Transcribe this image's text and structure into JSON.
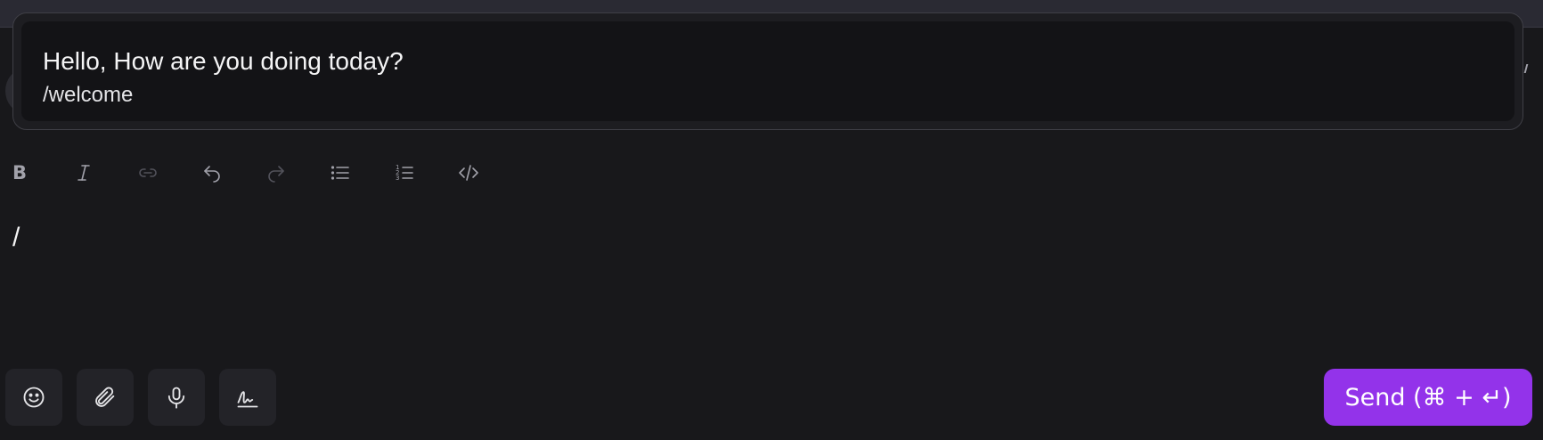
{
  "suggestion": {
    "title": "Hello, How are you doing today?",
    "command": "/welcome"
  },
  "editor": {
    "content": "/"
  },
  "toolbar": {
    "bold_label": "B",
    "items": [
      "bold",
      "italic",
      "link",
      "undo",
      "redo",
      "bullet-list",
      "ordered-list",
      "code"
    ]
  },
  "bottom_actions": [
    "emoji-icon",
    "paperclip-icon",
    "microphone-icon",
    "signature-icon"
  ],
  "send_button": {
    "label": "Send (⌘ + ↵)"
  },
  "colors": {
    "background": "#18181b",
    "accent": "#9333ea",
    "icon": "#a1a1aa",
    "icon_disabled": "#52525b"
  }
}
